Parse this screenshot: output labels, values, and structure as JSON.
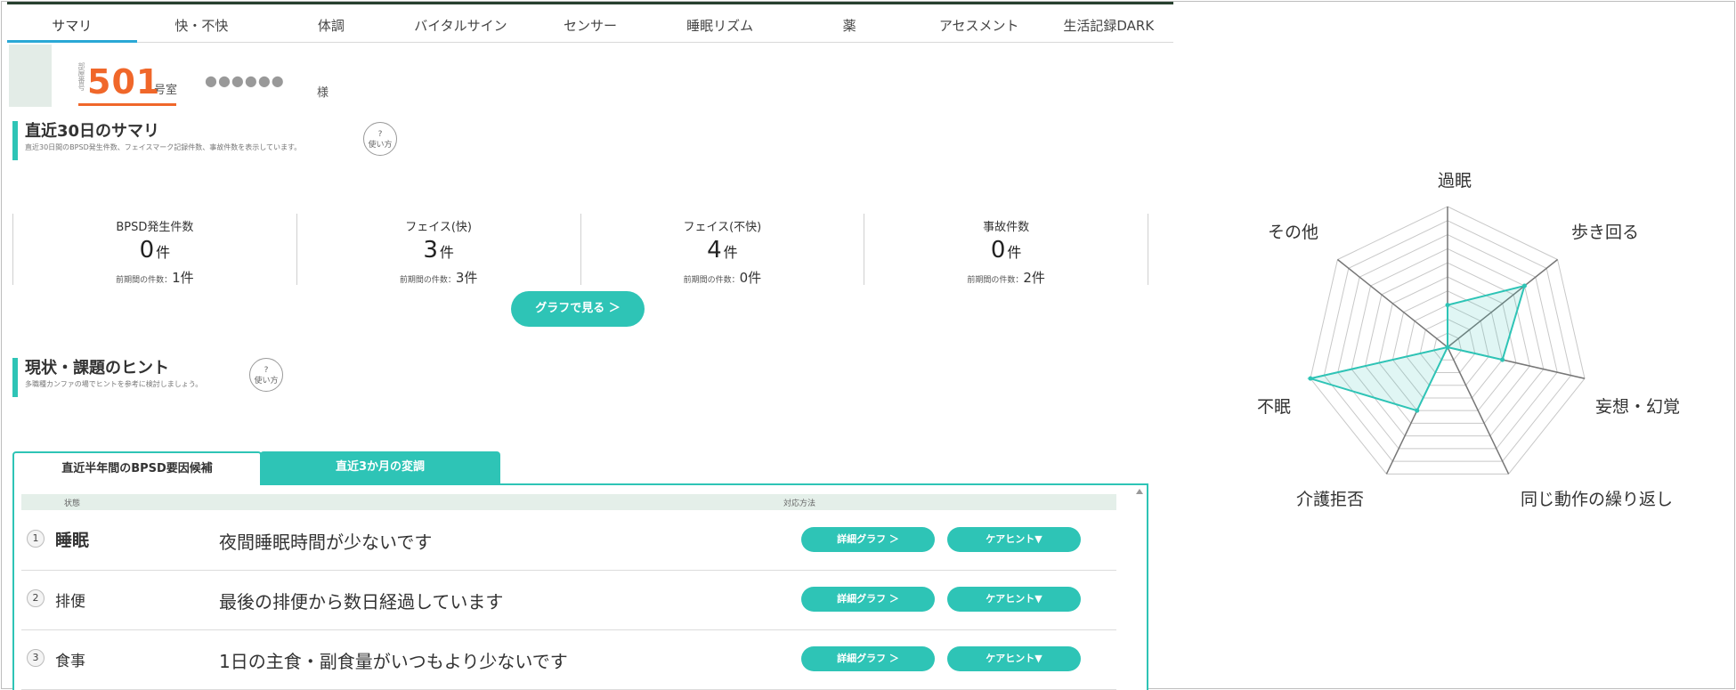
{
  "tabs": [
    "サマリ",
    "快・不快",
    "体調",
    "バイタルサイン",
    "センサー",
    "睡眠リズム",
    "薬",
    "アセスメント",
    "生活記録DARK"
  ],
  "room": {
    "caption": "部屋番号",
    "number": "501",
    "unit": "号室",
    "name": "●●●●●●",
    "suffix": "様"
  },
  "summary": {
    "title": "直近30日のサマリ",
    "desc": "直近30日間のBPSD発生件数、フェイスマーク記録件数、事故件数を表示しています。",
    "help": "使い方",
    "stats": [
      {
        "label": "BPSD発生件数",
        "value": "0",
        "unit": "件",
        "prev_label": "前期間の件数：",
        "prev_value": "1件"
      },
      {
        "label": "フェイス(快)",
        "value": "3",
        "unit": "件",
        "prev_label": "前期間の件数：",
        "prev_value": "3件"
      },
      {
        "label": "フェイス(不快)",
        "value": "4",
        "unit": "件",
        "prev_label": "前期間の件数：",
        "prev_value": "0件"
      },
      {
        "label": "事故件数",
        "value": "0",
        "unit": "件",
        "prev_label": "前期間の件数：",
        "prev_value": "2件"
      }
    ],
    "graph_button": "グラフで見る ＞"
  },
  "hints": {
    "title": "現状・課題のヒント",
    "desc": "多職種カンファの場でヒントを参考に検討しましょう。",
    "help": "使い方",
    "tab_active": "直近半年間のBPSD要因候補",
    "tab_inactive": "直近3か月の変調",
    "col_state": "状態",
    "col_action": "対応方法",
    "rows": [
      {
        "num": "1",
        "category": "睡眠",
        "text": "夜間睡眠時間が少ないです",
        "detail": "詳細グラフ ＞",
        "care": "ケアヒント▼"
      },
      {
        "num": "2",
        "category": "排便",
        "text": "最後の排便から数日経過しています",
        "detail": "詳細グラフ ＞",
        "care": "ケアヒント▼"
      },
      {
        "num": "3",
        "category": "食事",
        "text": "1日の主食・副食量がいつもより少ないです",
        "detail": "詳細グラフ ＞",
        "care": "ケアヒント▼"
      }
    ]
  },
  "chart_data": {
    "type": "radar",
    "axes": [
      "過眠",
      "歩き回る",
      "妄想・幻覚",
      "同じ動作の繰り返し",
      "介護拒否",
      "不眠",
      "その他"
    ],
    "levels": 10,
    "range": [
      0,
      10
    ],
    "series": [
      {
        "values": [
          3,
          7,
          4,
          0,
          5,
          10,
          0
        ],
        "color": "#2ec4b6"
      }
    ],
    "grid_color": "#c8c8c8",
    "axis_color": "#777777"
  }
}
